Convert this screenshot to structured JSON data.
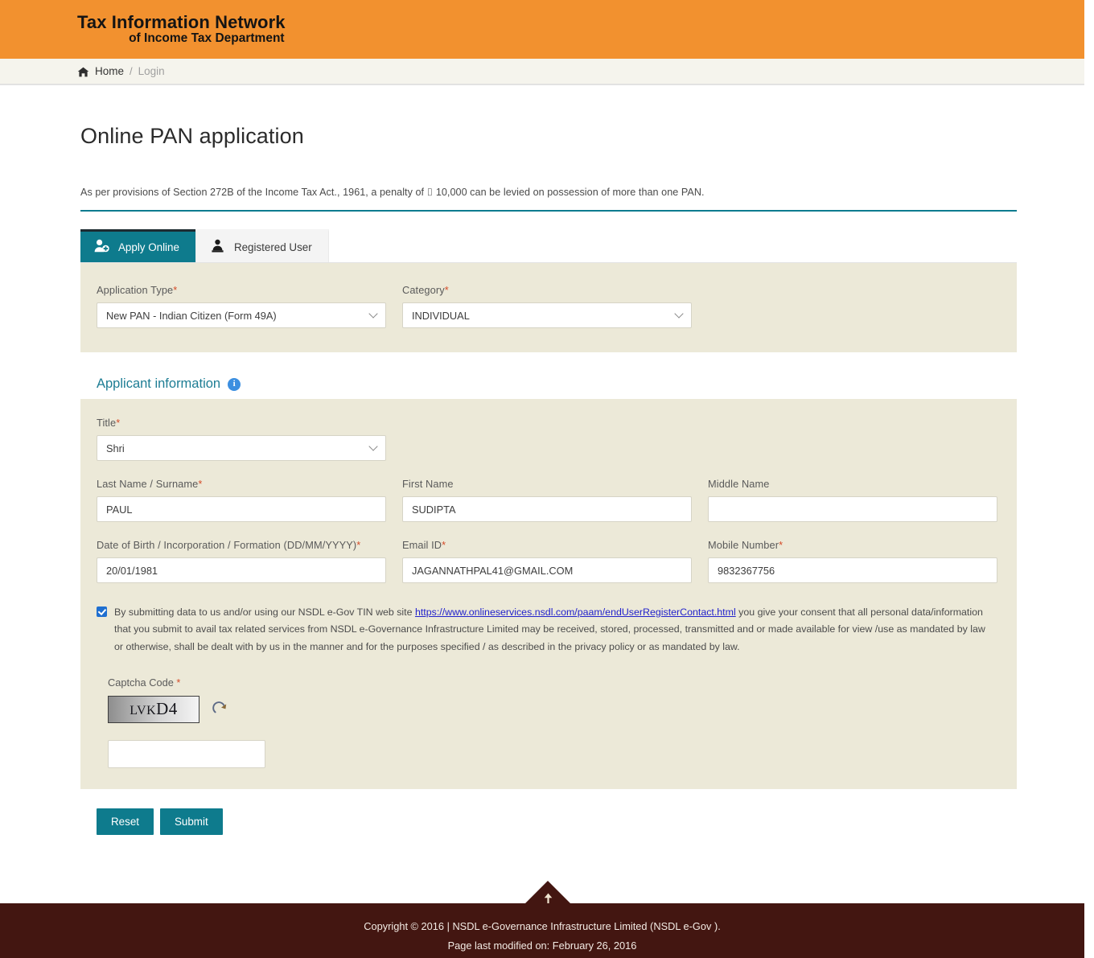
{
  "header": {
    "brand_line1": "Tax Information Network",
    "brand_line2": "of Income Tax Department",
    "brand_bg": "#f2912f"
  },
  "breadcrumb": {
    "home": "Home",
    "separator": "/",
    "current": "Login",
    "home_icon": "home-icon"
  },
  "main": {
    "page_title": "Online PAN application",
    "lead": "As per provisions of Section 272B of the Income Tax Act., 1961, a penalty of ⌷ 10,000 can be levied on possession of more than one PAN.",
    "accent_color": "#0e7b8d"
  },
  "tabs": [
    {
      "label": "Apply Online",
      "icon": "user-plus-icon",
      "active": true
    },
    {
      "label": "Registered User",
      "icon": "user-login-icon",
      "active": false
    }
  ],
  "application_panel": {
    "application_type": {
      "label": "Application Type",
      "required": "*",
      "value": "New PAN - Indian Citizen (Form 49A)"
    },
    "category": {
      "label": "Category",
      "required": "*",
      "value": "INDIVIDUAL"
    }
  },
  "applicant_section": {
    "heading": "Applicant information",
    "info_icon": "info-icon",
    "info_glyph": "i",
    "title": {
      "label": "Title",
      "required": "*",
      "value": "Shri"
    },
    "last_name": {
      "label": "Last Name / Surname",
      "required": "*",
      "value": "PAUL",
      "placeholder": ""
    },
    "first_name": {
      "label": "First Name",
      "required": "",
      "value": "SUDIPTA",
      "placeholder": ""
    },
    "middle_name": {
      "label": "Middle Name",
      "required": "",
      "value": "",
      "placeholder": ""
    },
    "dob": {
      "label": "Date of Birth / Incorporation / Formation (DD/MM/YYYY)",
      "required": "*",
      "value": "20/01/1981",
      "placeholder": ""
    },
    "email": {
      "label": "Email ID",
      "required": "*",
      "value": "JAGANNATHPAL41@GMAIL.COM",
      "placeholder": ""
    },
    "mobile": {
      "label": "Mobile Number",
      "required": "*",
      "value": "9832367756",
      "placeholder": ""
    }
  },
  "consent": {
    "checked": true,
    "text_before": "By submitting data to us and/or using our NSDL e-Gov TIN web site ",
    "link_text": "https://www.onlineservices.nsdl.com/paam/endUserRegisterContact.html",
    "text_after": " you give your consent that all personal data/information that you submit to avail tax related services from NSDL e-Governance Infrastructure Limited may be received, stored, processed, transmitted and or made available for view /use as mandated by law or otherwise, shall be dealt with by us in the manner and for the purposes specified / as described in the privacy policy or as mandated by law."
  },
  "captcha": {
    "label": "Captcha Code",
    "required": "*",
    "code_small": "LV",
    "code_mid": "K",
    "code_large": "D4",
    "code_full": "LVKD4",
    "refresh_icon": "refresh-icon",
    "input_value": "",
    "input_placeholder": ""
  },
  "buttons": {
    "reset": "Reset",
    "submit": "Submit"
  },
  "footer": {
    "back_to_top_icon": "arrow-up-icon",
    "copyright": "Copyright © 2016 | NSDL e-Governance Infrastructure Limited (NSDL e-Gov ).",
    "last_modified": "Page last modified on: February 26, 2016",
    "bg": "#431611"
  }
}
